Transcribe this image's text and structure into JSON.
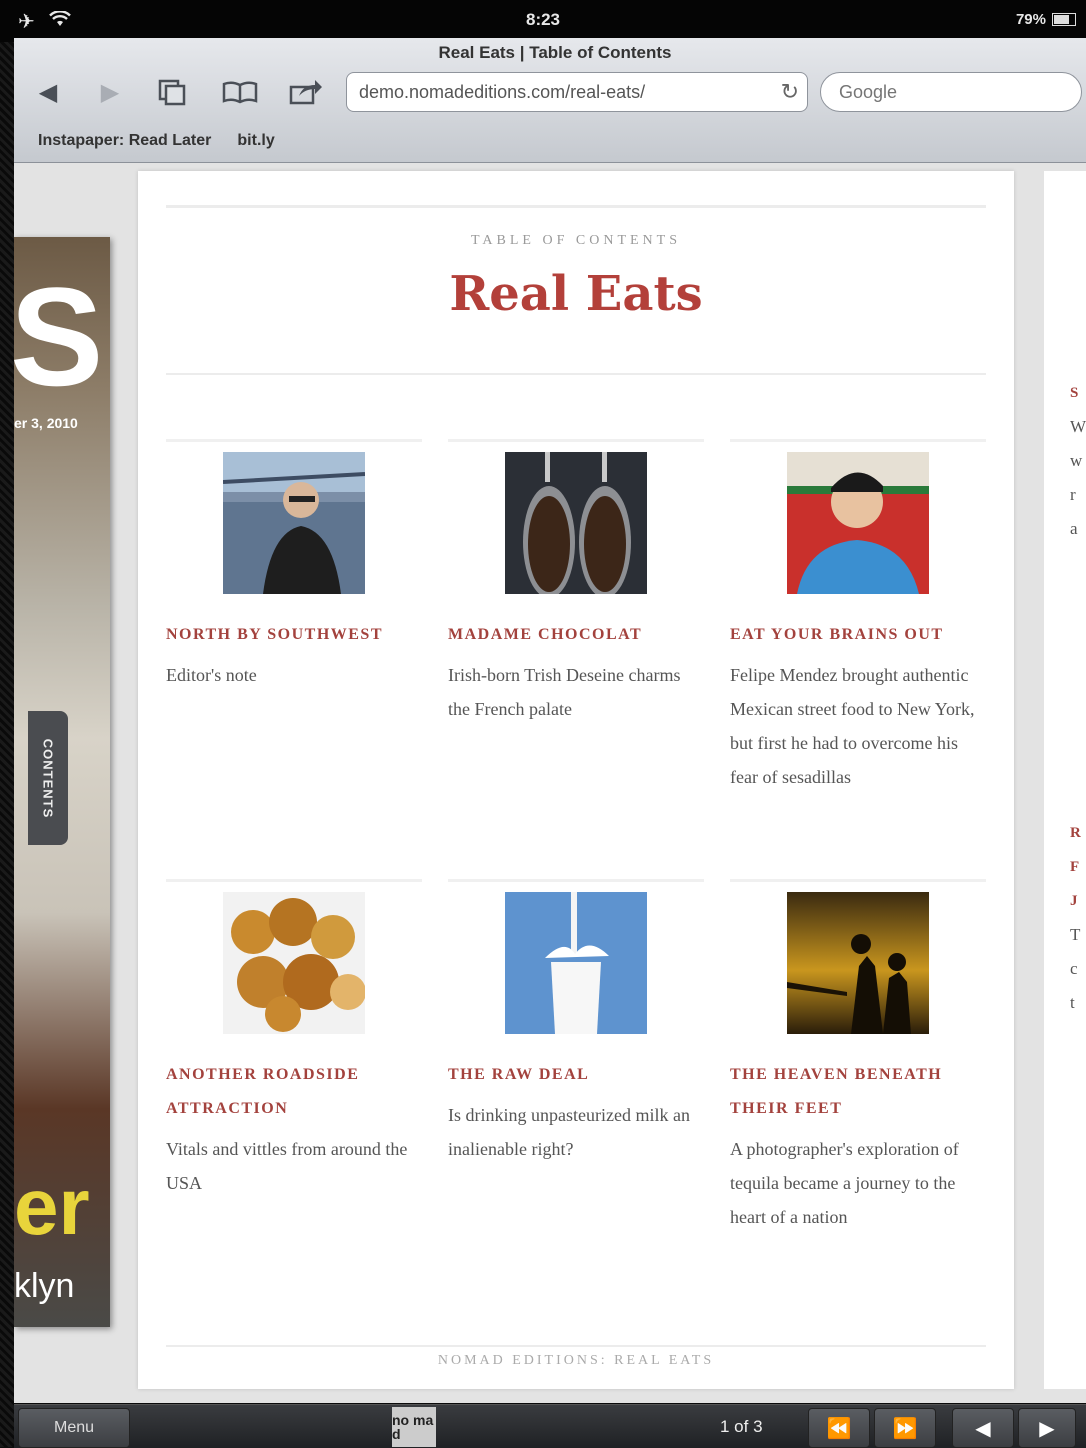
{
  "status_bar": {
    "time": "8:23",
    "battery": "79%"
  },
  "browser": {
    "page_title": "Real Eats | Table of Contents",
    "url": "demo.nomadeditions.com/real-eats/",
    "search_placeholder": "Google",
    "bookmarks": [
      "Instapaper: Read Later",
      "bit.ly"
    ]
  },
  "cover": {
    "date_fragment": "er 3, 2010",
    "title_fragment": "er",
    "subtitle_fragment": "klyn"
  },
  "contents_tab": "CONTENTS",
  "toc": {
    "kicker": "TABLE OF CONTENTS",
    "title": "Real Eats",
    "items": [
      {
        "heading": "NORTH BY SOUTHWEST",
        "description": "Editor's note",
        "image": "editor-portrait"
      },
      {
        "heading": "MADAME CHOCOLAT",
        "description": "Irish-born Trish Deseine charms the French palate",
        "image": "chocolate-scoops"
      },
      {
        "heading": "EAT YOUR BRAINS OUT",
        "description": "Felipe Mendez brought authentic Mexican street food to New York, but first he had to overcome his fear of sesadillas",
        "image": "smiling-man"
      },
      {
        "heading": "ANOTHER ROADSIDE ATTRACTION",
        "description": "Vitals and vittles from around the USA",
        "image": "fried-food"
      },
      {
        "heading": "THE RAW DEAL",
        "description": "Is drinking unpasteurized milk an inalienable right?",
        "image": "milk-glass"
      },
      {
        "heading": "THE HEAVEN BENEATH THEIR FEET",
        "description": "A photographer's exploration of tequila became a journey to the heart of a nation",
        "image": "silhouette-sunset"
      }
    ],
    "footer": "NOMAD EDITIONS: REAL EATS"
  },
  "next_page_fragments": [
    "S",
    "W",
    "w",
    "r",
    "a",
    "R",
    "F",
    "J",
    "T",
    "c",
    "t"
  ],
  "bottom_bar": {
    "menu_label": "Menu",
    "logo_text": "no ma d",
    "page_indicator": "1 of 3"
  },
  "colors": {
    "accent": "#b3403a",
    "heading": "#a3423d"
  }
}
